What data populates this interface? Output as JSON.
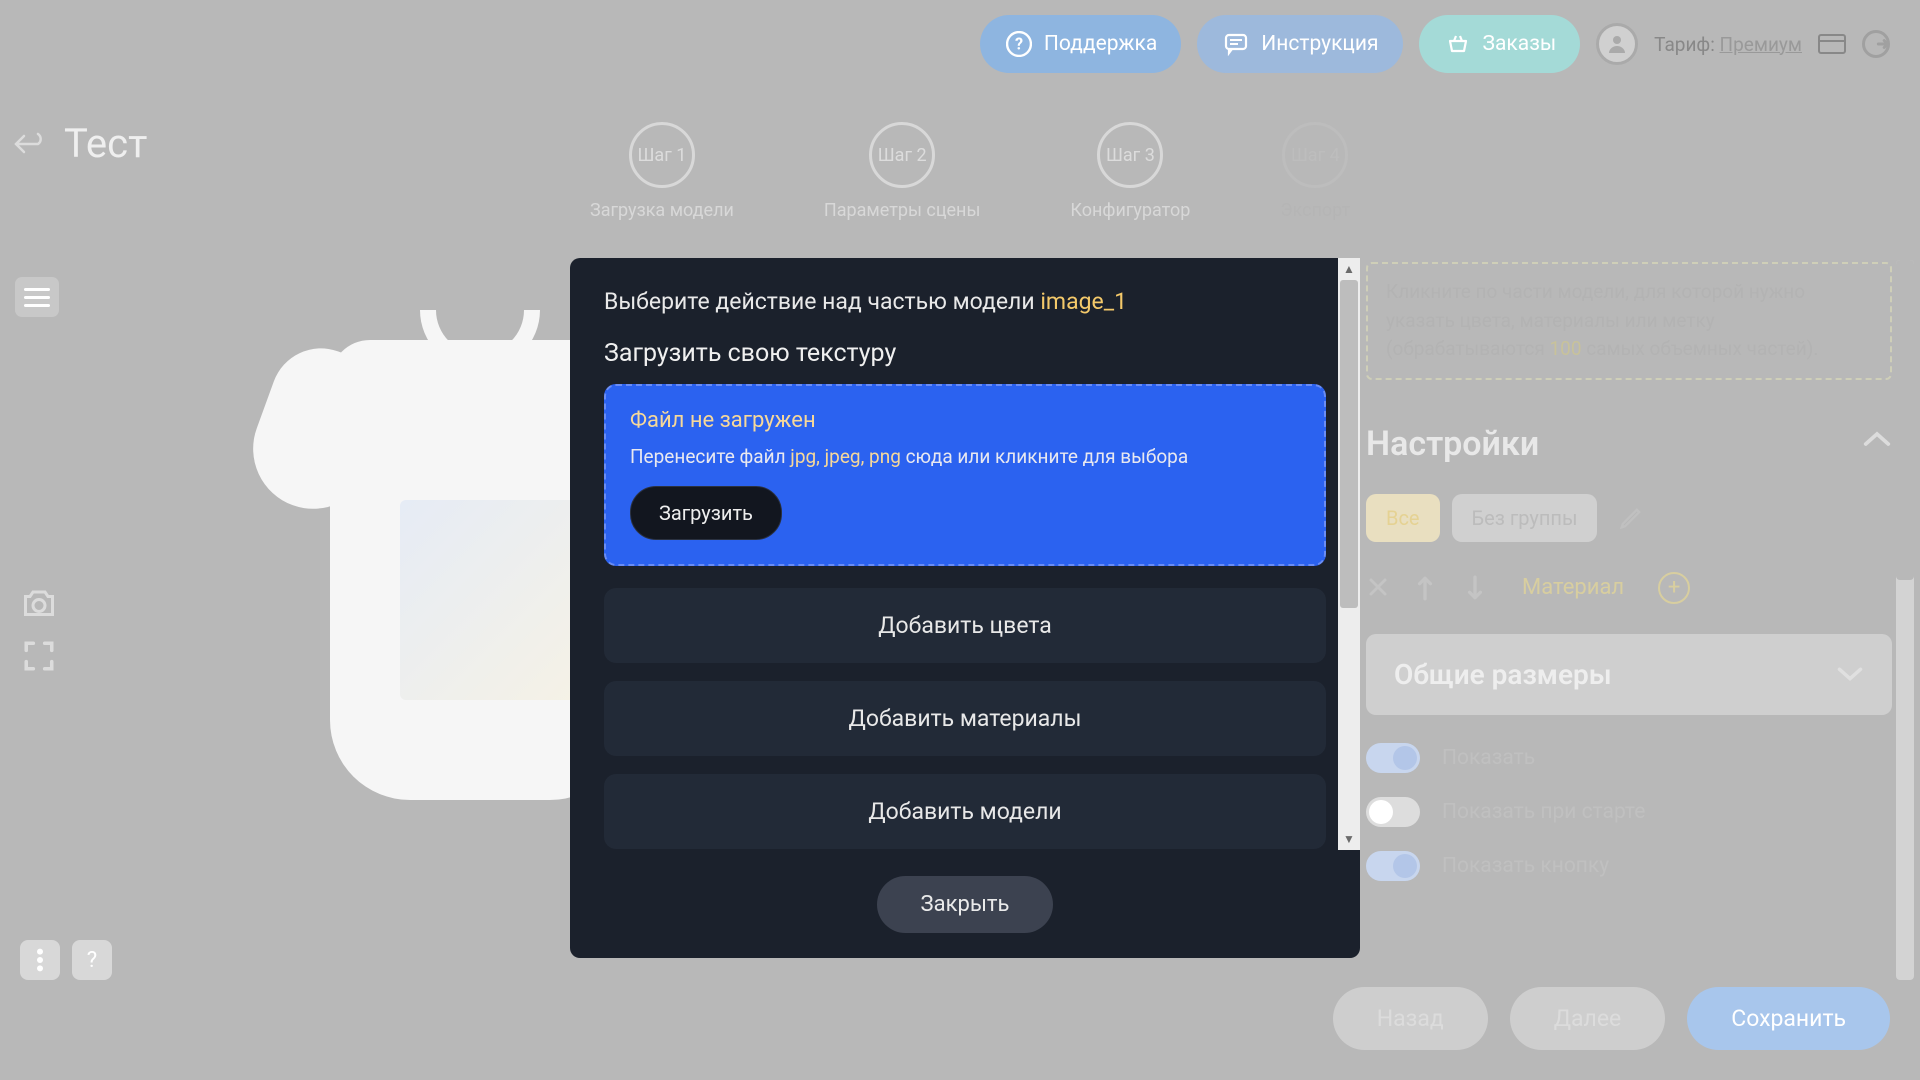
{
  "header": {
    "support": "Поддержка",
    "instructions": "Инструкция",
    "orders": "Заказы",
    "tariff_label": "Тариф:",
    "tariff_value": "Премиум"
  },
  "page_title": "Тест",
  "steps": [
    {
      "num": "Шаг 1",
      "label": "Загрузка модели",
      "active": true
    },
    {
      "num": "Шаг 2",
      "label": "Параметры сцены",
      "active": true
    },
    {
      "num": "Шаг 3",
      "label": "Конфигуратор",
      "active": true
    },
    {
      "num": "Шаг 4",
      "label": "Экспорт",
      "active": false
    }
  ],
  "info_box": {
    "prefix": "Кликните по части модели, для которой нужно указать цвета, материалы или метку (обрабатываются ",
    "num": "100",
    "suffix": " самых объемных частей)."
  },
  "settings": {
    "title": "Настройки",
    "group_all": "Все",
    "group_none": "Без группы",
    "material_label": "Материал",
    "sizes_title": "Общие размеры",
    "toggles": {
      "show": {
        "label": "Показать",
        "on": true
      },
      "show_start": {
        "label": "Показать при старте",
        "on": false
      },
      "show_button": {
        "label": "Показать кнопку",
        "on": true
      }
    }
  },
  "bottom": {
    "back": "Назад",
    "next": "Далее",
    "save": "Сохранить"
  },
  "modal": {
    "title_prefix": "Выберите действие над частью модели ",
    "title_model": "image_1",
    "subtitle": "Загрузить свою текстуру",
    "dz_status": "Файл не загружен",
    "dz_hint_pre": "Перенесите файл ",
    "dz_ext": "jpg, jpeg, png",
    "dz_hint_post": " сюда или кликните для выбора",
    "dz_btn": "Загрузить",
    "actions": [
      "Добавить цвета",
      "Добавить материалы",
      "Добавить модели"
    ],
    "close": "Закрыть"
  }
}
